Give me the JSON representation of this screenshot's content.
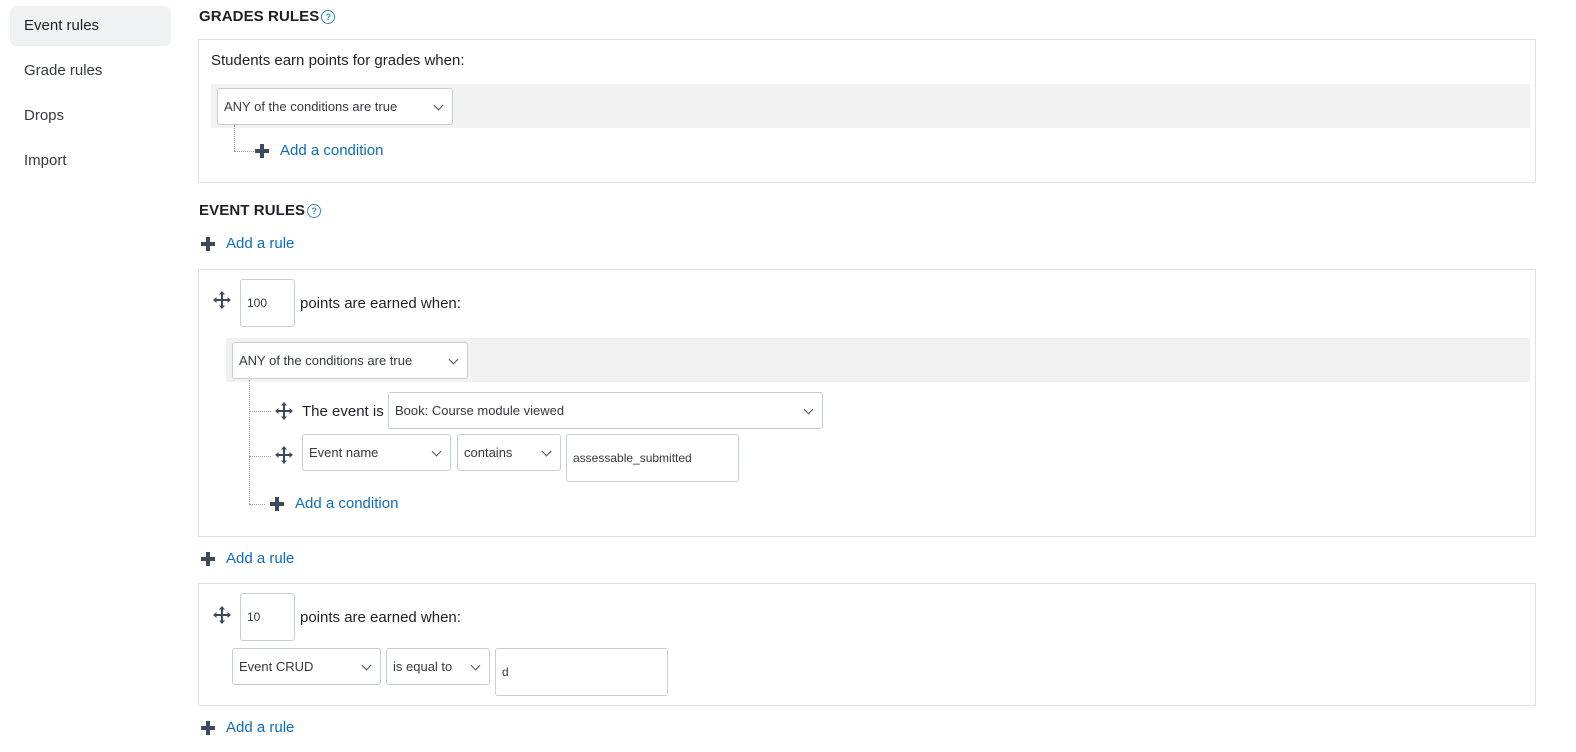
{
  "sidebar": {
    "items": [
      {
        "label": "Event rules",
        "active": true
      },
      {
        "label": "Grade rules",
        "active": false
      },
      {
        "label": "Drops",
        "active": false
      },
      {
        "label": "Import",
        "active": false
      }
    ]
  },
  "help_icon_glyph": "?",
  "grades": {
    "title": "GRADES RULES",
    "intro": "Students earn points for grades when:",
    "condition_select": "ANY of the conditions are true",
    "add_condition": "Add a condition"
  },
  "events": {
    "title": "EVENT RULES",
    "add_rule": "Add a rule",
    "rules": [
      {
        "points": "100",
        "points_label": "points are earned when:",
        "condition_select": "ANY of the conditions are true",
        "event_is_label": "The event is",
        "event_select": "Book: Course module viewed",
        "property_select": "Event name",
        "operator_select": "contains",
        "value": "assessable_submitted",
        "add_condition": "Add a condition"
      },
      {
        "points": "10",
        "points_label": "points are earned when:",
        "property_select": "Event CRUD",
        "operator_select": "is equal to",
        "value": "d"
      }
    ]
  },
  "colors": {
    "link": "#0f6cbf",
    "active_nav": "#f0f1f3",
    "band": "#f1f1f1",
    "border": "#dee2e6"
  }
}
